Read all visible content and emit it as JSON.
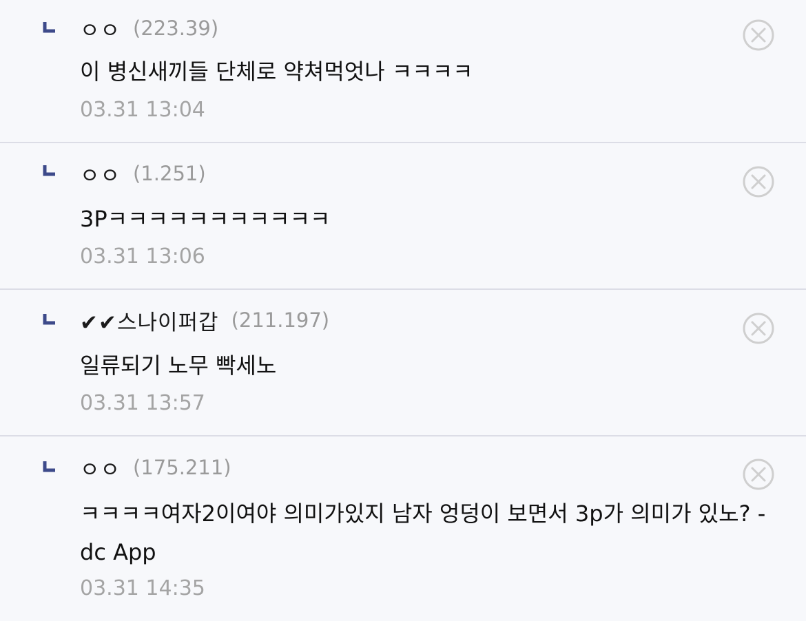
{
  "replies": [
    {
      "nickname": "ㅇㅇ",
      "ip": "(223.39)",
      "text": "이 병신새끼들 단체로 약쳐먹엇나 ㅋㅋㅋㅋ",
      "time": "03.31 13:04",
      "delete_icon": "close-circle-icon",
      "marker_icon": "reply-arrow-icon"
    },
    {
      "nickname": "ㅇㅇ",
      "ip": "(1.251)",
      "text": "3Pㅋㅋㅋㅋㅋㅋㅋㅋㅋㅋㅋ",
      "time": "03.31 13:06",
      "delete_icon": "close-circle-icon",
      "marker_icon": "reply-arrow-icon"
    },
    {
      "nickname": "✔✔스나이퍼갑",
      "ip": "(211.197)",
      "text": "일류되기 노무 빡세노",
      "time": "03.31 13:57",
      "delete_icon": "close-circle-icon",
      "marker_icon": "reply-arrow-icon"
    },
    {
      "nickname": "ㅇㅇ",
      "ip": "(175.211)",
      "text": "ㅋㅋㅋㅋ여자2이여야 의미가있지 남자 엉덩이 보면서 3p가 의미가 있노? - dc App",
      "time": "03.31 14:35",
      "delete_icon": "close-circle-icon",
      "marker_icon": "reply-arrow-icon"
    }
  ],
  "colors": {
    "background": "#f7f8fb",
    "divider": "#dcdde6",
    "marker": "#3d4a8a",
    "ip_text": "#9a9a9a",
    "timestamp": "#a4a4a4",
    "delete_icon": "#cfcfcf"
  }
}
